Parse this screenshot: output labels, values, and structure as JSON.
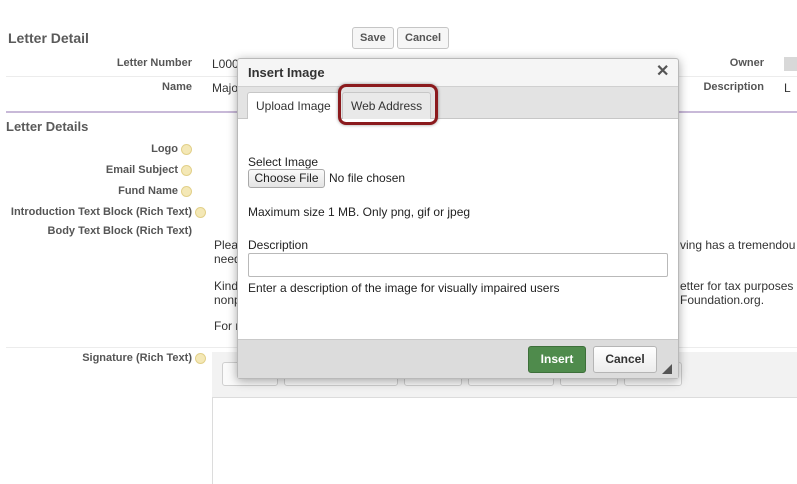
{
  "page": {
    "title": "Letter Detail",
    "save_label": "Save",
    "cancel_label": "Cancel"
  },
  "fields": {
    "letter_number_label": "Letter Number",
    "letter_number_value": "L000",
    "name_label": "Name",
    "name_value": "Majo",
    "owner_label": "Owner",
    "description_label": "Description",
    "description_value": "L"
  },
  "section": {
    "title": "Letter Details",
    "logo_label": "Logo",
    "email_subject_label": "Email Subject",
    "fund_name_label": "Fund Name",
    "intro_label": "Introduction Text Block (Rich Text)",
    "body_label": "Body Text Block (Rich Text)",
    "signature_label": "Signature (Rich Text)"
  },
  "body_text": {
    "line1_left": "Plea",
    "line1_right": "ving has a tremendou",
    "line2_left": "need",
    "line3_left": "Kind",
    "line3_right": "etter for tax purposes",
    "line4_left": "nonp",
    "line4_right": "Foundation.org.",
    "line5_left": "For r"
  },
  "modal": {
    "title": "Insert Image",
    "close_glyph": "✕",
    "tabs": [
      {
        "label": "Upload Image",
        "active": true
      },
      {
        "label": "Web Address",
        "active": false
      }
    ],
    "select_image_label": "Select Image",
    "choose_file_label": "Choose File",
    "no_file_text": "No file chosen",
    "max_size_text": "Maximum size 1 MB. Only png, gif or jpeg",
    "description_label": "Description",
    "description_value": "",
    "description_help": "Enter a description of the image for visually impaired users",
    "insert_label": "Insert",
    "cancel_label": "Cancel"
  },
  "colors": {
    "insert_button": "#4f8b4c",
    "highlight_ring": "#8b1a1d",
    "section_rule": "#c8b9d8"
  }
}
